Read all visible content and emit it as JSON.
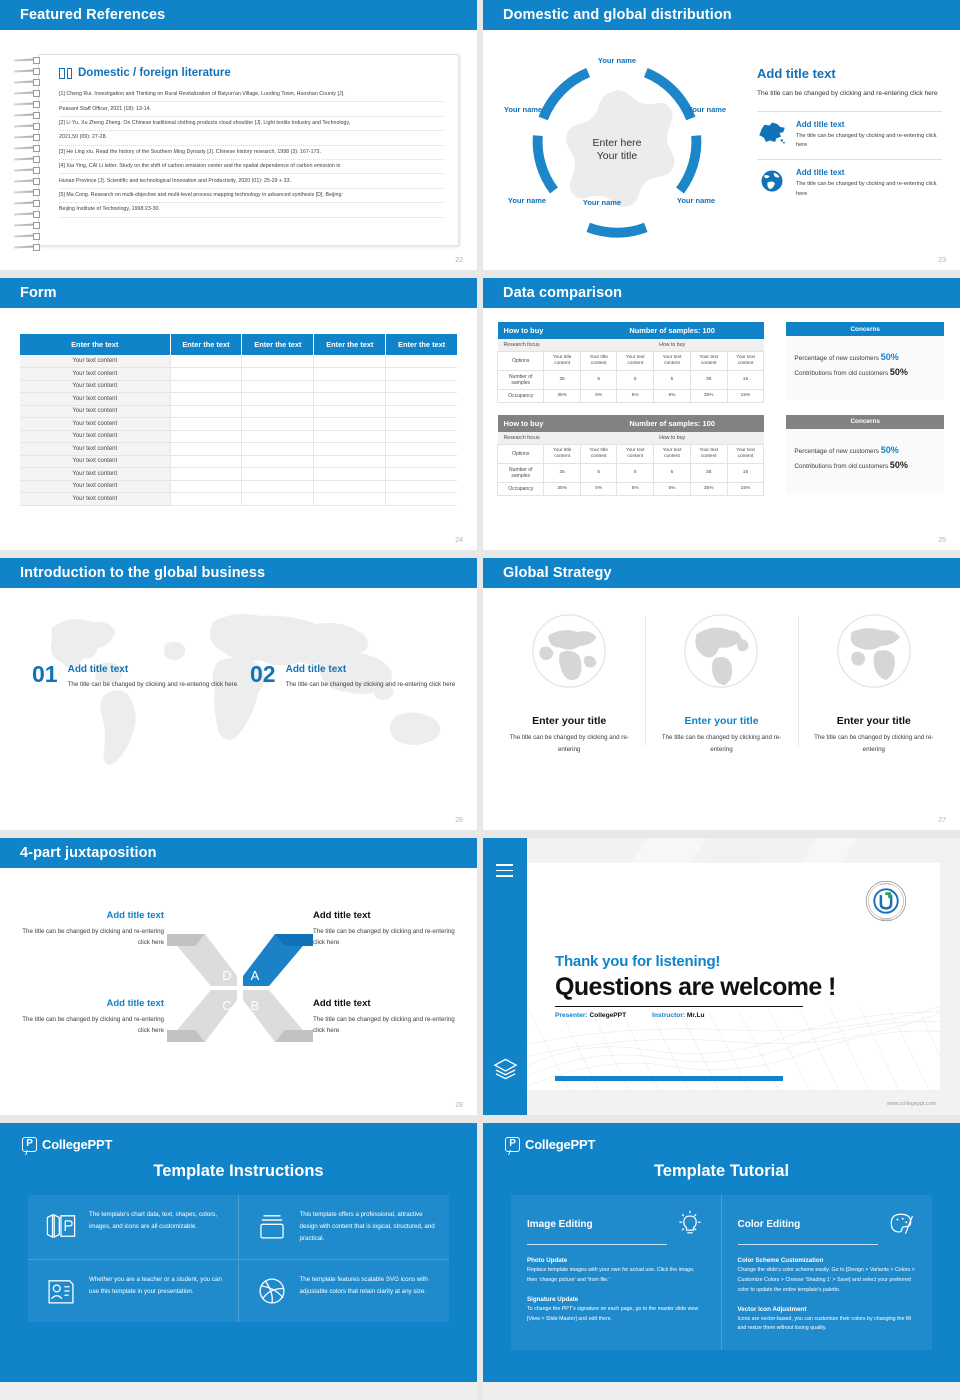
{
  "theme": {
    "accent": "#1083c9",
    "accent_dark": "#1272b8",
    "gray": "#828282"
  },
  "slides": {
    "references": {
      "title": "Featured References",
      "page": "22",
      "card_title": "Domestic / foreign literature",
      "items": [
        "[1] Cheng Rui. Investigation and Thinking on Rural Revitalization of Baiyun'an Village, Luoding Town, Huoshan County [J].",
        "Peasant Staff Officer, 2021 (18): 13-14.",
        "[2] Li Yu, Xu Zheng Zheng. On Chinese traditional clothing products cloud shoulder [J]. Light textile Industry and Technology,",
        "2021,50 (09): 27-28.",
        "[3] He Ling xiu. Read the history of the Southern Ming Dynasty [J]. Chinese history research, 1998 (3): 167-173.",
        "[4] Xia Ying, CAI Li letter. Study on the shift of carbon emission center and the spatial dependence of carbon emission in",
        "Hunan Province [J]. Scientific and technological Innovation and Productivity, 2020 (01): 25-29 + 33.",
        "[5] Ma Cong. Research on multi-objective and multi-level process mapping technology in advanced synthesis [D]. Beijing:",
        "Beijing Institute of Technology, 1998:23-30."
      ]
    },
    "distribution": {
      "title": "Domestic and global distribution",
      "page": "23",
      "hub_line1": "Enter here",
      "hub_line2": "Your title",
      "captions": [
        "Your name",
        "Your name",
        "Your name",
        "Your name",
        "Your name",
        "Your name"
      ],
      "right_title": "Add title text",
      "right_body": "The title can be changed by clicking and re-entering click here",
      "rows": [
        {
          "icon": "china-map-icon",
          "title": "Add title text",
          "body": "The title can be changed by clicking and re-entering click here"
        },
        {
          "icon": "globe-icon",
          "title": "Add title text",
          "body": "The title can be changed by clicking and re-entering click here"
        }
      ]
    },
    "form": {
      "title": "Form",
      "page": "24",
      "headers": [
        "Enter the text",
        "Enter the text",
        "Enter the text",
        "Enter the text",
        "Enter the text"
      ],
      "first_col_value": "Your text content",
      "row_count": 12
    },
    "data_comparison": {
      "title": "Data comparison",
      "page": "25",
      "tables": [
        {
          "accent": "blue",
          "h_left": "How to buy",
          "h_right": "Number of samples: 100",
          "s_left": "Research focus",
          "s_right": "How to buy",
          "row_labels": [
            "Options",
            "Number of samples",
            "Occupancy"
          ],
          "option_cells": [
            "Your title content",
            "Your title content",
            "Your text content",
            "Your text content",
            "Your text content",
            "Your text content"
          ],
          "samples": [
            "35",
            "5",
            "5",
            "5",
            "35",
            "15"
          ],
          "occupancy": [
            "35%",
            "5%",
            "5%",
            "5%",
            "35%",
            "15%"
          ]
        },
        {
          "accent": "gray",
          "h_left": "How to buy",
          "h_right": "Number of samples: 100",
          "s_left": "Research focus",
          "s_right": "How to buy",
          "row_labels": [
            "Options",
            "Number of samples",
            "Occupancy"
          ],
          "option_cells": [
            "Your title content",
            "Your title content",
            "Your text content",
            "Your text content",
            "Your text content",
            "Your text content"
          ],
          "samples": [
            "35",
            "5",
            "5",
            "5",
            "35",
            "15"
          ],
          "occupancy": [
            "35%",
            "5%",
            "5%",
            "5%",
            "35%",
            "15%"
          ]
        }
      ],
      "concerns": [
        {
          "accent": "blue",
          "title": "Concerns",
          "line1_label": "Percentage of new customers",
          "line1_value": "50%",
          "line2_label": "Contributions from old customers",
          "line2_value": "50%"
        },
        {
          "accent": "gray",
          "title": "Concerns",
          "line1_label": "Percentage of new customers",
          "line1_value": "50%",
          "line2_label": "Contributions from old customers",
          "line2_value": "50%"
        }
      ]
    },
    "global_business": {
      "title": "Introduction to the global business",
      "page": "26",
      "items": [
        {
          "num": "01",
          "title": "Add title text",
          "body": "The title can be changed by clicking and re-entering click here"
        },
        {
          "num": "02",
          "title": "Add title text",
          "body": "The title can be changed by clicking and re-entering click here"
        }
      ]
    },
    "global_strategy": {
      "title": "Global Strategy",
      "page": "27",
      "items": [
        {
          "title": "Enter your title",
          "body": "The title can be changed by clicking and re-entering",
          "color": "dark"
        },
        {
          "title": "Enter your title",
          "body": "The title can be changed by clicking and re-entering",
          "color": "blue"
        },
        {
          "title": "Enter your title",
          "body": "The title can be changed by clicking and re-entering",
          "color": "dark"
        }
      ]
    },
    "juxtaposition": {
      "title": "4-part juxtaposition",
      "page": "28",
      "letters": [
        "A",
        "B",
        "C",
        "D"
      ],
      "items": [
        {
          "title": "Add title text",
          "body": "The title can be changed by clicking and re-entering click here",
          "color": "blue"
        },
        {
          "title": "Add title text",
          "body": "The title can be changed by clicking and re-entering click here",
          "color": "dark"
        },
        {
          "title": "Add title text",
          "body": "The title can be changed by clicking and re-entering click here",
          "color": "blue"
        },
        {
          "title": "Add title text",
          "body": "The title can be changed by clicking and re-entering click here",
          "color": "dark"
        }
      ]
    },
    "thank_you": {
      "headline": "Thank you for listening!",
      "subhead": "Questions are welcome !",
      "presenter_label": "Presenter:",
      "presenter_value": "CollegePPT",
      "instructor_label": "Instructor:",
      "instructor_value": "Mr.Lu",
      "url": "www.collegeppt.com"
    },
    "instructions": {
      "brand": "CollegePPT",
      "title": "Template Instructions",
      "cells": [
        {
          "icon": "ppt-pages-icon",
          "text": "The template's chart data, text, shapes, colors, images, and icons are all customizable."
        },
        {
          "icon": "box-icon",
          "text": "This template offers a professional, attractive design with content that is logical, structured, and practical."
        },
        {
          "icon": "id-card-icon",
          "text": "Whether you are a teacher or a student, you can use this template in your presentation."
        },
        {
          "icon": "basketball-icon",
          "text": "The template features scalable SVG icons with adjustable colors that retain clarity at any size."
        }
      ]
    },
    "tutorial": {
      "brand": "CollegePPT",
      "title": "Template Tutorial",
      "columns": [
        {
          "heading": "Image Editing",
          "icon": "lightbulb-icon",
          "sections": [
            {
              "sub": "Photo Update",
              "body": "Replace template images with your own for actual use. Click the image, then 'change picture' and 'from file.'"
            },
            {
              "sub": "Signature Update",
              "body": "To change the PPT's signature on each page, go to the master slide view [View > Slide Master] and edit there."
            }
          ]
        },
        {
          "heading": "Color Editing",
          "icon": "palette-icon",
          "sections": [
            {
              "sub": "Color Scheme Customization",
              "body": "Change the slide's color scheme easily. Go to [Design > Variants > Colors > Customize Colors > Choose 'Shading 1' > Save] and select your preferred color to update the entire template's palette."
            },
            {
              "sub": "Vector Icon Adjustment",
              "body": "Icons are vector-based, you can customize their colors by changing the fill and resize them without losing quality."
            }
          ]
        }
      ]
    }
  }
}
